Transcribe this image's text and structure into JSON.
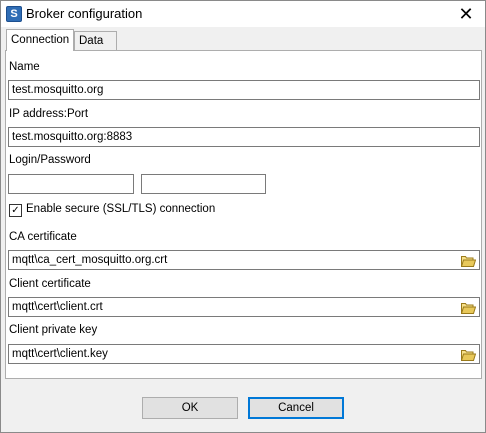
{
  "window": {
    "title": "Broker configuration",
    "icon": "S"
  },
  "tabs": [
    {
      "label": "Connection"
    },
    {
      "label": "Data format"
    }
  ],
  "form": {
    "name_label": "Name",
    "name_value": "test.mosquitto.org",
    "ip_label": "IP address:Port",
    "ip_value": "test.mosquitto.org:8883",
    "login_label": "Login/Password",
    "login_value": "",
    "password_value": "",
    "secure_checked": true,
    "secure_label": "Enable secure (SSL/TLS) connection",
    "ca_label": "CA certificate",
    "ca_value": "mqtt\\ca_cert_mosquitto.org.crt",
    "client_cert_label": "Client certificate",
    "client_cert_value": "mqtt\\cert\\client.crt",
    "client_key_label": "Client private key",
    "client_key_value": "mqtt\\cert\\client.key"
  },
  "buttons": {
    "ok": "OK",
    "cancel": "Cancel"
  },
  "colors": {
    "accent": "#0078d7",
    "folder": "#e8c85a"
  }
}
